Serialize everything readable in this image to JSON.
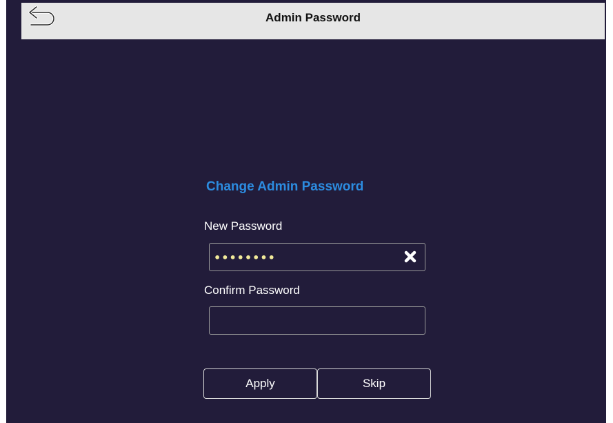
{
  "header": {
    "title": "Admin Password",
    "back_icon": "back-arrow-icon"
  },
  "form": {
    "heading": "Change Admin Password",
    "new_password": {
      "label": "New Password",
      "value": "••••••••",
      "clear_icon": "close-icon"
    },
    "confirm_password": {
      "label": "Confirm Password",
      "value": ""
    },
    "apply_label": "Apply",
    "skip_label": "Skip"
  },
  "colors": {
    "background": "#221c3a",
    "header_bg": "#e6e6e6",
    "heading": "#2c8ce0",
    "password_dots": "#f2ea9a"
  }
}
